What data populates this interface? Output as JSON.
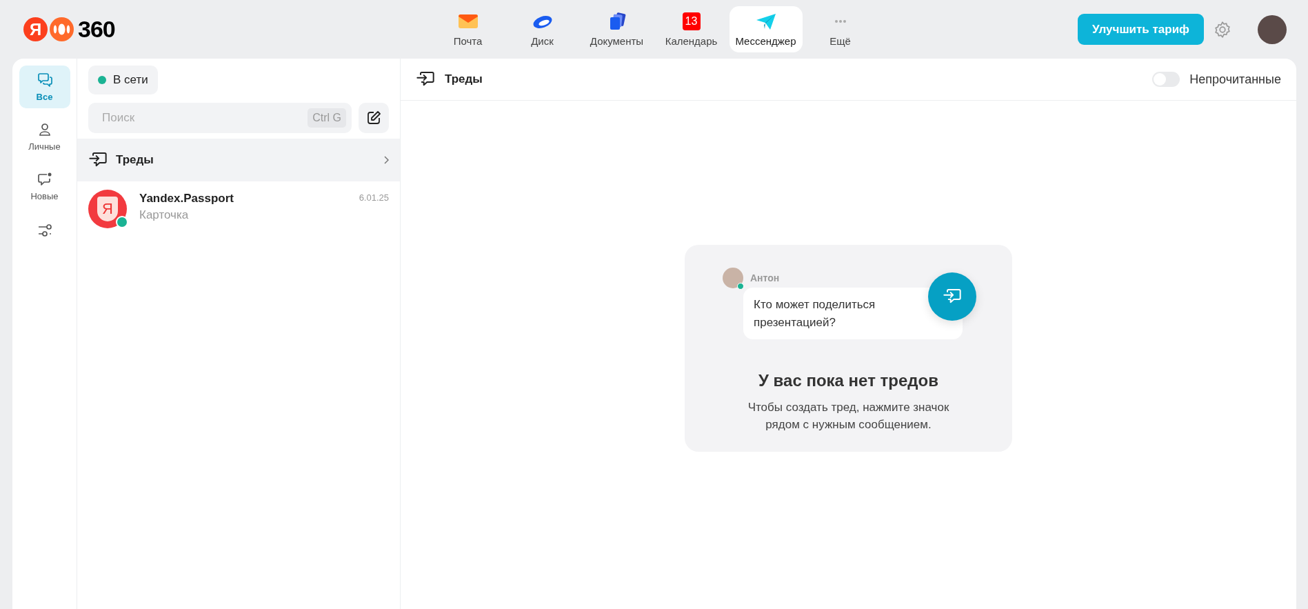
{
  "logo": {
    "mark": "Я",
    "text": "360"
  },
  "apps": [
    {
      "label": "Почта",
      "kind": "mail",
      "selected": false
    },
    {
      "label": "Диск",
      "kind": "disk",
      "selected": false
    },
    {
      "label": "Документы",
      "kind": "docs",
      "selected": false
    },
    {
      "label": "Календарь",
      "kind": "calendar",
      "badge": "13",
      "selected": false
    },
    {
      "label": "Мессенджер",
      "kind": "messenger",
      "selected": true
    },
    {
      "label": "Ещё",
      "kind": "more",
      "selected": false
    }
  ],
  "header": {
    "upgrade_button": "Улучшить тариф"
  },
  "rail": [
    {
      "label": "Все",
      "kind": "all",
      "selected": true
    },
    {
      "label": "Личные",
      "kind": "personal",
      "selected": false
    },
    {
      "label": "Новые",
      "kind": "new",
      "selected": false
    }
  ],
  "status": {
    "label": "В сети",
    "online": true
  },
  "search": {
    "placeholder": "Поиск",
    "shortcut": "Ctrl G"
  },
  "threads_row": {
    "label": "Треды"
  },
  "chats": [
    {
      "name": "Yandex.Passport",
      "preview": "Карточка",
      "date": "6.01.25",
      "avatar_letter": "Я",
      "online": true,
      "selected": false
    }
  ],
  "main": {
    "title": "Треды",
    "unread_toggle": {
      "label": "Непрочитанные",
      "on": false
    }
  },
  "empty_state": {
    "sender": "Антон",
    "sender_online": true,
    "message": "Кто может поделиться презентацией?",
    "title": "У вас пока нет тредов",
    "description": "Чтобы создать тред, нажмите значок рядом с нужным сообщением."
  }
}
